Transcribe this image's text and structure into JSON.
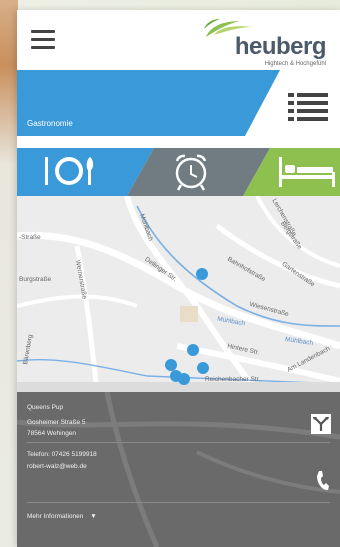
{
  "header": {
    "logo_name": "heuberg",
    "logo_tagline": "Hightech & Hochgefühl",
    "menu_icon": "hamburger-icon"
  },
  "banner": {
    "category_label": "Gastronomie",
    "list_icon": "list-view-icon",
    "color": "#3a9ad9"
  },
  "category_tabs": [
    {
      "name": "Gastronomie",
      "icon": "plate-cutlery-icon",
      "color": "#3a9ad9"
    },
    {
      "name": "Wecker",
      "icon": "alarm-clock-icon",
      "color": "#707c82"
    },
    {
      "name": "Übernachtung",
      "icon": "bed-icon",
      "color": "#8dc04f"
    }
  ],
  "map": {
    "streets": [
      "Mühlbach",
      "Bergstraße",
      "Gartenstraße",
      "Bahnhofstraße",
      "Dellinger Str.",
      "Wiesenstraße",
      "Mühlbach",
      "Mühlbach",
      "Hintere Str.",
      "Reichenbacher Str.",
      "Am Landenbach",
      "Lerchenstraße",
      "-Straße",
      "Burgstraße",
      "Wernerstraße",
      "Bärenberg"
    ],
    "marker_color": "#3a9ad9"
  },
  "info": {
    "name": "Queens Pup",
    "street": "Gosheimer Straße 5",
    "city": "78564 Wehingen",
    "phone": "Telefon: 07426 5199918",
    "email": "robert-walz@web.de",
    "more_label": "Mehr Informationen",
    "more_icon": "caret-down-icon",
    "route_icon": "route-sign-icon",
    "phone_icon": "phone-icon"
  }
}
